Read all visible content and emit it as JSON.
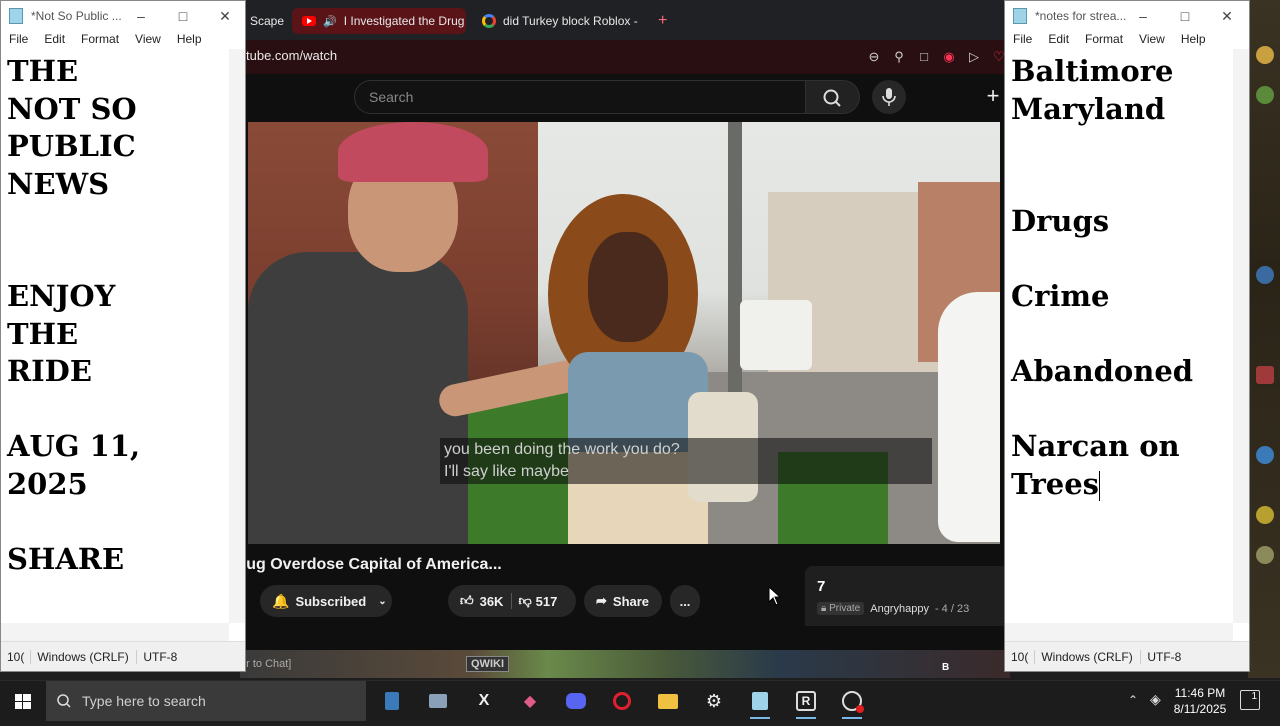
{
  "browser": {
    "tabs": [
      {
        "label": "Scape",
        "active": false
      },
      {
        "label": "I Investigated the Drug",
        "active": true
      },
      {
        "label": "did Turkey block Roblox -",
        "active": false
      }
    ],
    "new_tab_label": "+",
    "url": "tube.com/watch",
    "search_placeholder": "Search",
    "video": {
      "captions": [
        "you been doing the work you do?",
        "I'll say like maybe"
      ],
      "title": "rug Overdose Capital of America...",
      "subscribe_label": "Subscribed",
      "likes": "36K",
      "dislikes": "517",
      "share_label": "Share",
      "more_label": "..."
    },
    "playlist": {
      "count": "7",
      "privacy": "Private",
      "owner": "Angryhappy",
      "position": "- 4 / 23"
    }
  },
  "game": {
    "chat_hint": "er to Chat]",
    "qwiki": "QWIKI",
    "b_marker": "B"
  },
  "notepad_left": {
    "title": "*Not So Public ...",
    "menu": [
      "File",
      "Edit",
      "Format",
      "View",
      "Help"
    ],
    "content": "THE\nNOT SO\nPUBLIC\nNEWS\n\n\nENJOY\nTHE\nRIDE\n\nAUG 11,\n2025\n\nSHARE",
    "status": [
      "10(",
      "Windows (CRLF)",
      "UTF-8"
    ]
  },
  "notepad_right": {
    "title": "*notes for strea...",
    "menu": [
      "File",
      "Edit",
      "Format",
      "View",
      "Help"
    ],
    "content": "Baltimore\nMaryland\n\n\nDrugs\n\nCrime\n\nAbandoned\n\nNarcan on\nTrees",
    "status": [
      "10(",
      "Windows (CRLF)",
      "UTF-8"
    ]
  },
  "taskbar": {
    "search_placeholder": "Type here to search",
    "time": "11:46 PM",
    "date": "8/11/2025",
    "notification_count": "1"
  },
  "colors": {
    "youtube_red": "#ff0000",
    "active_tab": "#5a1418",
    "taskbar": "#1c1c1c"
  }
}
